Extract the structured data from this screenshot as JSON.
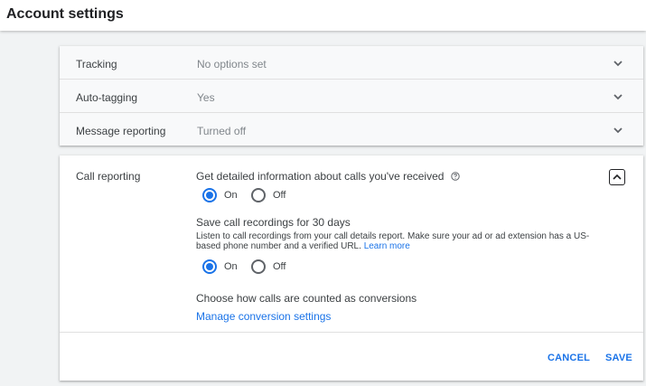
{
  "page": {
    "title": "Account settings"
  },
  "colors": {
    "accent": "#1a73e8",
    "text": "#3c4043",
    "muted": "#80868b",
    "background": "#f1f3f4"
  },
  "settings": {
    "rows": [
      {
        "label": "Tracking",
        "value": "No options set"
      },
      {
        "label": "Auto-tagging",
        "value": "Yes"
      },
      {
        "label": "Message reporting",
        "value": "Turned off"
      }
    ]
  },
  "call_reporting": {
    "label": "Call reporting",
    "calls_info": "Get detailed information about calls you've received",
    "calls_radio": {
      "on_label": "On",
      "off_label": "Off",
      "selected": "On"
    },
    "recordings_title": "Save call recordings for 30 days",
    "recordings_desc": "Listen to call recordings from your call details report. Make sure your ad or ad extension has a US-based phone number and a verified URL.",
    "learn_more": "Learn more",
    "recordings_radio": {
      "on_label": "On",
      "off_label": "Off",
      "selected": "On"
    },
    "conversions_text": "Choose how calls are counted as conversions",
    "manage_link": "Manage conversion settings",
    "cancel_label": "CANCEL",
    "save_label": "SAVE"
  }
}
